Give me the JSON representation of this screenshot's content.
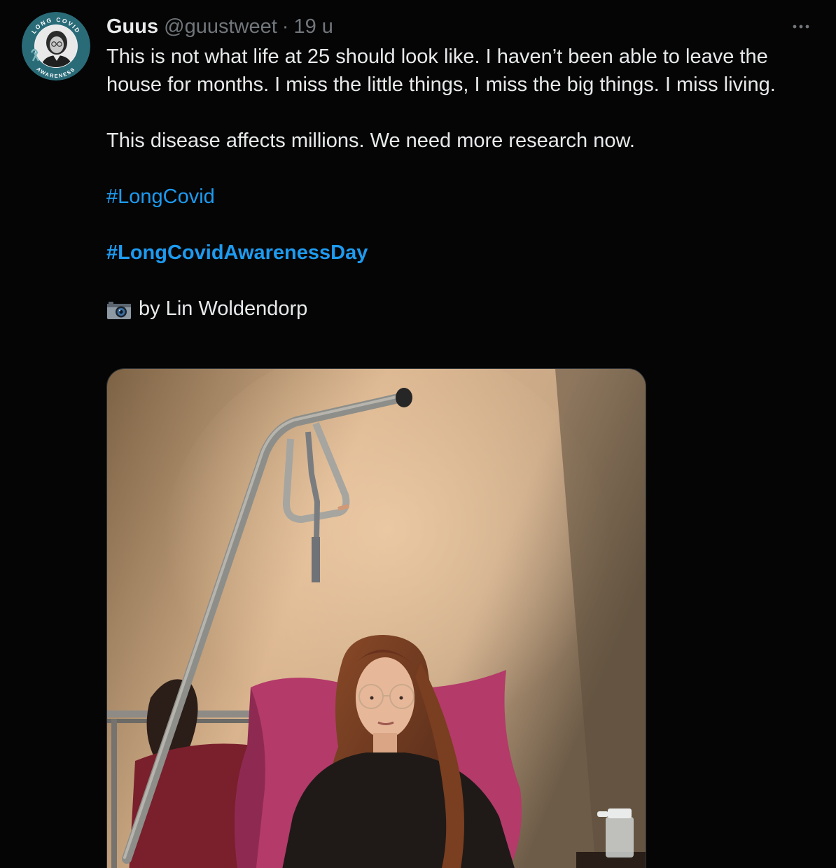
{
  "author": {
    "display_name": "Guus",
    "handle": "@guustweet",
    "separator": "·",
    "time": "19 u",
    "avatar_badge_top": "LONG COVID",
    "avatar_badge_bottom": "AWARENESS"
  },
  "tweet": {
    "paragraph_1": "This is not what life at 25 should look like. I haven’t been able to leave the house for months. I miss the little things, I miss the big things. I miss living.",
    "paragraph_2": "This disease affects millions. We need more research now.",
    "hashtag_1": "#LongCovid",
    "hashtag_2": "#LongCovidAwarenessDay",
    "credit": "by Lin Woldendorp",
    "credit_icon": "camera-icon"
  },
  "media": {
    "description_icon": "photo",
    "subject": "woman-in-hospital-bed"
  },
  "colors": {
    "background": "#050505",
    "text": "#e7e9ea",
    "secondary_text": "#71767b",
    "link": "#1d9bf0",
    "avatar_ring": "#2a6b78"
  }
}
